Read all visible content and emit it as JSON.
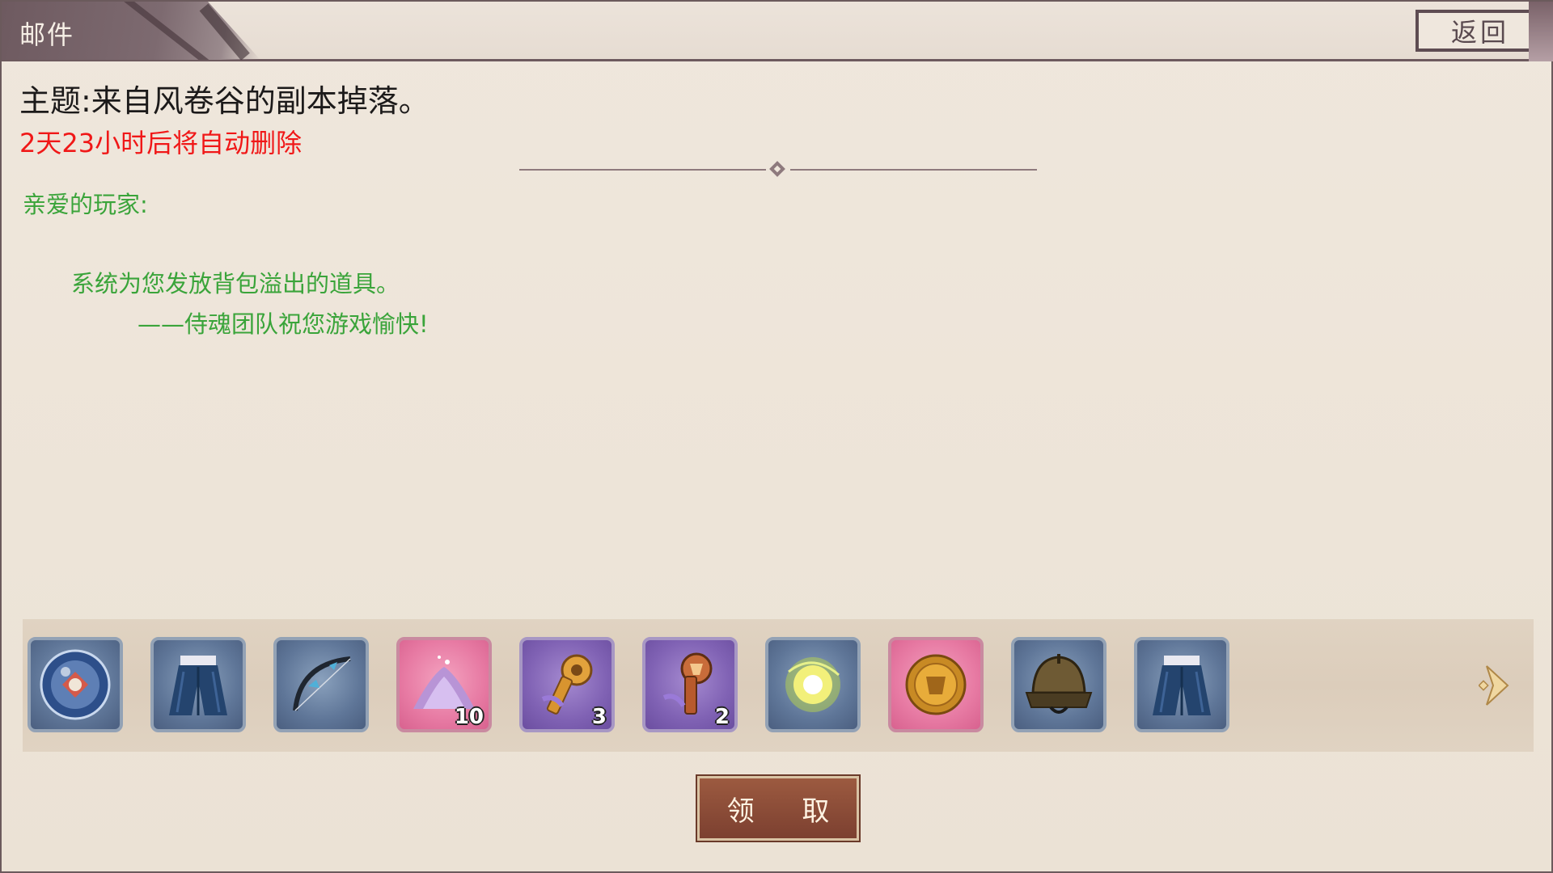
{
  "header": {
    "title": "邮件",
    "back_label": "返回"
  },
  "mail": {
    "subject": "主题:来自风卷谷的副本掉落。",
    "expiry": "2天23小时后将自动删除",
    "greeting": "亲爱的玩家:",
    "body": "系统为您发放背包溢出的道具。",
    "signature": "——侍魂团队祝您游戏愉快!"
  },
  "rewards": [
    {
      "name": "soul-orb-icon",
      "rarity": "blue",
      "count": ""
    },
    {
      "name": "hakama-pants-icon",
      "rarity": "blue",
      "count": ""
    },
    {
      "name": "bow-icon",
      "rarity": "blue",
      "count": ""
    },
    {
      "name": "crystal-powder-icon",
      "rarity": "pink",
      "count": "10"
    },
    {
      "name": "gold-key-icon",
      "rarity": "purple",
      "count": "3"
    },
    {
      "name": "bronze-key-icon",
      "rarity": "purple",
      "count": "2"
    },
    {
      "name": "light-orb-icon",
      "rarity": "blue",
      "count": ""
    },
    {
      "name": "soul-coin-icon",
      "rarity": "pink",
      "count": ""
    },
    {
      "name": "samurai-helmet-icon",
      "rarity": "blue",
      "count": ""
    },
    {
      "name": "hakama-pants-icon",
      "rarity": "blue",
      "count": ""
    }
  ],
  "actions": {
    "claim_label": "领 取"
  },
  "colors": {
    "expiry": "#f01818",
    "body_text": "#3aa43a",
    "claim_button": "#8a4a35"
  }
}
